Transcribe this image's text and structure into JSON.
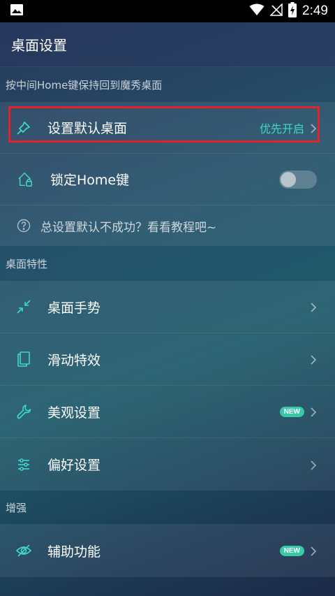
{
  "status_bar": {
    "time": "2:49",
    "icons": [
      "image-icon",
      "wifi-icon",
      "no-signal-icon",
      "battery-charging-icon"
    ]
  },
  "header": {
    "title": "桌面设置"
  },
  "section_home": {
    "label": "按中间Home键保持回到魔秀桌面",
    "rows": [
      {
        "label": "设置默认桌面",
        "value": "优先开启",
        "icon": "pin-icon"
      },
      {
        "label": "锁定Home键",
        "toggle": false,
        "icon": "home-lock-icon"
      },
      {
        "label": "总设置默认不成功？看看教程吧~",
        "icon": "help-circle-icon"
      }
    ]
  },
  "section_features": {
    "label": "桌面特性",
    "rows": [
      {
        "label": "桌面手势",
        "icon": "collapse-arrows-icon"
      },
      {
        "label": "滑动特效",
        "icon": "copy-pages-icon"
      },
      {
        "label": "美观设置",
        "badge": "NEW",
        "icon": "wrench-icon"
      },
      {
        "label": "偏好设置",
        "icon": "sliders-icon"
      }
    ]
  },
  "section_enhance": {
    "label": "增强",
    "rows": [
      {
        "label": "辅助功能",
        "badge": "NEW",
        "icon": "eye-slash-icon"
      }
    ]
  },
  "colors": {
    "accent": "#3fd8c8",
    "badge": "#38c9a8",
    "highlight": "#e0222a"
  }
}
